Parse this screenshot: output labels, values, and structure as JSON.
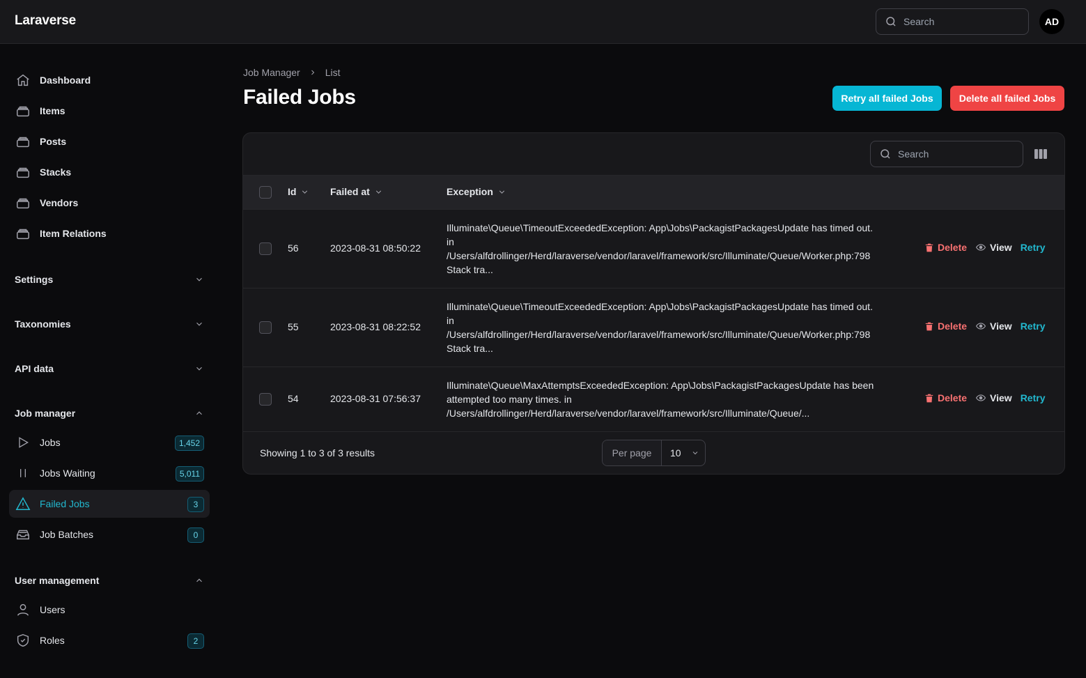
{
  "app": {
    "brand": "Laraverse",
    "search_placeholder": "Search",
    "avatar_initials": "AD"
  },
  "sidebar": {
    "top_items": [
      {
        "label": "Dashboard",
        "icon": "home-icon"
      },
      {
        "label": "Items",
        "icon": "stack-icon"
      },
      {
        "label": "Posts",
        "icon": "stack-icon"
      },
      {
        "label": "Stacks",
        "icon": "stack-icon"
      },
      {
        "label": "Vendors",
        "icon": "stack-icon"
      },
      {
        "label": "Item Relations",
        "icon": "stack-icon"
      }
    ],
    "groups": {
      "settings": {
        "label": "Settings",
        "expanded": false
      },
      "taxonomies": {
        "label": "Taxonomies",
        "expanded": false
      },
      "api_data": {
        "label": "API data",
        "expanded": false
      },
      "job_manager": {
        "label": "Job manager",
        "expanded": true,
        "items": [
          {
            "label": "Jobs",
            "badge": "1,452",
            "icon": "play-icon"
          },
          {
            "label": "Jobs Waiting",
            "badge": "5,011",
            "icon": "pause-icon"
          },
          {
            "label": "Failed Jobs",
            "badge": "3",
            "icon": "warning-icon",
            "active": true
          },
          {
            "label": "Job Batches",
            "badge": "0",
            "icon": "inbox-stack-icon"
          }
        ]
      },
      "user_management": {
        "label": "User management",
        "expanded": true,
        "items": [
          {
            "label": "Users",
            "icon": "user-icon"
          },
          {
            "label": "Roles",
            "badge": "2",
            "icon": "shield-check-icon"
          }
        ]
      }
    }
  },
  "breadcrumb": {
    "parent": "Job Manager",
    "current": "List"
  },
  "page": {
    "title": "Failed Jobs",
    "retry_all_label": "Retry all failed Jobs",
    "delete_all_label": "Delete all failed Jobs"
  },
  "table": {
    "search_placeholder": "Search",
    "columns": {
      "id": "Id",
      "failed_at": "Failed at",
      "exception": "Exception"
    },
    "rows": [
      {
        "id": "56",
        "failed_at": "2023-08-31 08:50:22",
        "exception_lines": [
          "Illuminate\\Queue\\TimeoutExceededException: App\\Jobs\\PackagistPackagesUpdate has timed out.",
          "in",
          "/Users/alfdrollinger/Herd/laraverse/vendor/laravel/framework/src/Illuminate/Queue/Worker.php:798",
          "Stack tra..."
        ]
      },
      {
        "id": "55",
        "failed_at": "2023-08-31 08:22:52",
        "exception_lines": [
          "Illuminate\\Queue\\TimeoutExceededException: App\\Jobs\\PackagistPackagesUpdate has timed out.",
          "in",
          "/Users/alfdrollinger/Herd/laraverse/vendor/laravel/framework/src/Illuminate/Queue/Worker.php:798",
          "Stack tra..."
        ]
      },
      {
        "id": "54",
        "failed_at": "2023-08-31 07:56:37",
        "exception_lines": [
          "Illuminate\\Queue\\MaxAttemptsExceededException: App\\Jobs\\PackagistPackagesUpdate has been",
          "attempted too many times. in",
          "/Users/alfdrollinger/Herd/laraverse/vendor/laravel/framework/src/Illuminate/Queue/..."
        ]
      }
    ],
    "actions": {
      "delete": "Delete",
      "view": "View",
      "retry": "Retry"
    },
    "footer": {
      "showing": "Showing 1 to 3 of 3 results",
      "per_page_label": "Per page",
      "per_page_value": "10"
    }
  },
  "colors": {
    "accent": "#06b6d4",
    "danger": "#ef4444",
    "background": "#0b0b0d",
    "surface": "#18181b"
  }
}
